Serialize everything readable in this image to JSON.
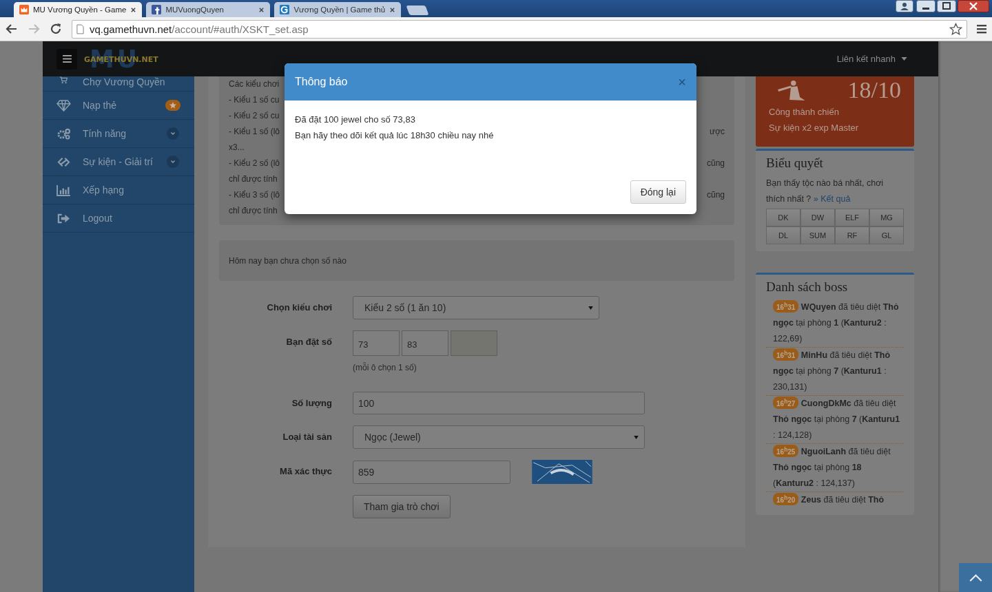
{
  "browser": {
    "tabs": [
      {
        "title": "MU Vương Quyền - Game",
        "selected": true,
        "kind": "crown"
      },
      {
        "title": "MUVuongQuyen",
        "selected": false,
        "kind": "square"
      },
      {
        "title": "Vương Quyền | Game thủ",
        "selected": false,
        "kind": "round"
      }
    ],
    "url": {
      "host": "vq.gamethuvn.net",
      "path": "/account/#auth/XSKT_set.asp"
    }
  },
  "navbar": {
    "logo_mark": "MU",
    "logo_text": "GAMETHUVN.NET",
    "quick_links": "Liên kết nhanh"
  },
  "sidebar": {
    "items": [
      {
        "label": "Chợ Vương Quyền",
        "kind": "plain"
      },
      {
        "label": "Nạp thẻ",
        "kind": "star"
      },
      {
        "label": "Tính năng",
        "kind": "chevron"
      },
      {
        "label": "Sự kiện - Giải trí",
        "kind": "chevron"
      },
      {
        "label": "Xếp hạng",
        "kind": "plain"
      },
      {
        "label": "Logout",
        "kind": "plain"
      }
    ]
  },
  "rules": {
    "lines": [
      {
        "left": "Các kiểu chơi"
      },
      {
        "left": "- Kiểu 1 số cu"
      },
      {
        "left": "- Kiểu 2 số cu"
      },
      {
        "left": "- Kiểu 1 số (lô",
        "right": "ược"
      },
      {
        "left": "x3..."
      },
      {
        "left": "- Kiểu 2 số (lô",
        "right": "cũng"
      },
      {
        "left": "chỉ được tính"
      },
      {
        "left": "- Kiểu 3 số (lô",
        "right": "cũng"
      },
      {
        "left": "chỉ được tính"
      }
    ]
  },
  "notice": "Hôm nay bạn chưa chọn số nào",
  "form": {
    "fields": [
      {
        "label": "Chọn kiểu chơi",
        "kind": "select",
        "value": "Kiểu 2 số (1 ăn 10)"
      },
      {
        "label": "Bạn đặt số",
        "kind": "numbers",
        "cells": [
          {
            "value": "73",
            "disabled": false
          },
          {
            "value": "83",
            "disabled": false
          },
          {
            "disabled": true
          }
        ],
        "help": "(mỗi ô chọn 1 số)"
      },
      {
        "label": "Số lượng",
        "kind": "input",
        "value": "100"
      },
      {
        "label": "Loại tài sản",
        "kind": "select",
        "value": "Ngọc (Jewel)"
      },
      {
        "label": "Mã xác thực",
        "kind": "captcha",
        "value": "859"
      }
    ],
    "submit": "Tham gia trò chơi"
  },
  "event": {
    "date": "18/10",
    "lines": [
      "Công thành chiến",
      "Sự kiện x2 exp Master"
    ]
  },
  "poll": {
    "title": "Biểu quyết",
    "question": "Bạn thấy tộc nào bá nhất, chơi thích nhất ?",
    "link": "» Kết quả",
    "options": [
      "DK",
      "DW",
      "ELF",
      "MG",
      "DL",
      "SUM",
      "RF",
      "GL"
    ]
  },
  "boss": {
    "title": "Danh sách boss",
    "entries": [
      {
        "time": "16$^{h}$31",
        "text": "**WQuyen** đã tiêu diệt **Thỏ ngọc** tại phòng **1** (**Kanturu2** : 122,69)"
      },
      {
        "time": "16$^{h}$31",
        "text": "**MinHu** đã tiêu diệt **Thỏ ngọc** tại phòng **7** (**Kanturu1** : 230,131)"
      },
      {
        "time": "16$^{h}$27",
        "text": "**CuongDkMc** đã tiêu diệt **Thỏ ngọc** tại phòng **7** (**Kanturu1** : 124,128)"
      },
      {
        "time": "16$^{h}$25",
        "text": "**NguoiLanh** đã tiêu diệt **Thỏ ngọc** tại phòng **18** (**Kanturu2** : 124,137)"
      },
      {
        "time": "16$^{h}$20",
        "text": "**Zeus** đã tiêu diệt **Thỏ**"
      }
    ]
  },
  "modal": {
    "title": "Thông báo",
    "close": "×",
    "lines": [
      "Đã đặt 100 jewel cho số 73,83",
      "Bạn hãy theo dõi kết quả lúc 18h30 chiều nay nhé"
    ],
    "button": "Đóng lại"
  }
}
